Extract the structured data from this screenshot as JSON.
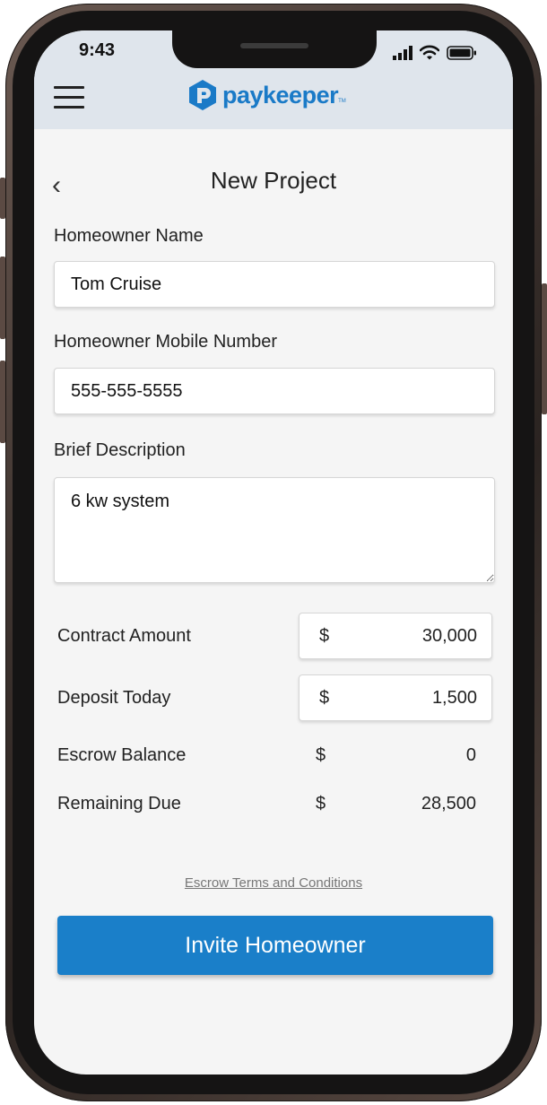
{
  "status_bar": {
    "time": "9:43"
  },
  "header": {
    "brand": "paykeeper",
    "brand_mark": "TM",
    "brand_color": "#1a7ac7"
  },
  "page": {
    "title": "New Project"
  },
  "form": {
    "name_label": "Homeowner Name",
    "name_value": "Tom Cruise",
    "mobile_label": "Homeowner Mobile Number",
    "mobile_value": "555-555-5555",
    "description_label": "Brief Description",
    "description_value": "6 kw system"
  },
  "amounts": {
    "contract_label": "Contract Amount",
    "contract_currency": "$",
    "contract_value": "30,000",
    "deposit_label": "Deposit Today",
    "deposit_currency": "$",
    "deposit_value": "1,500",
    "escrow_label": "Escrow Balance",
    "escrow_currency": "$",
    "escrow_value": "0",
    "remaining_label": "Remaining Due",
    "remaining_currency": "$",
    "remaining_value": "28,500"
  },
  "terms_link": "Escrow Terms and Conditions",
  "invite_button": "Invite Homeowner",
  "accent_color": "#1a7fc9"
}
